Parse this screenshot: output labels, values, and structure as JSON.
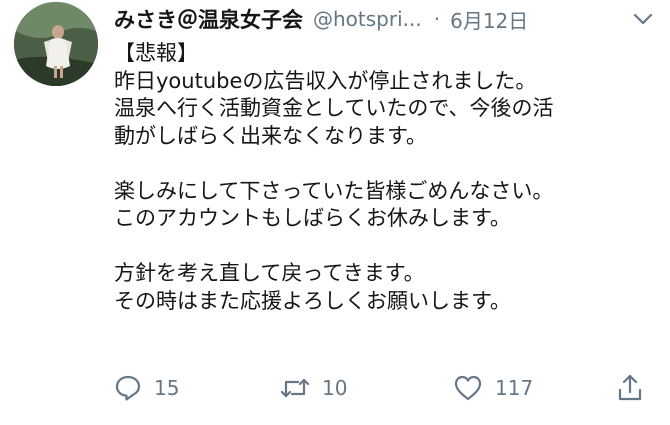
{
  "tweet": {
    "author": {
      "display_name": "みさき＠温泉女子会",
      "handle": "@hotspri...",
      "avatar_icon": "avatar-photo"
    },
    "separator": "·",
    "date": "6月12日",
    "menu_icon": "chevron-down-icon",
    "text_lines": [
      "【悲報】",
      "昨日youtubeの広告収入が停止されました。",
      "温泉へ行く活動資金としていたので、今後の活",
      "動がしばらく出来なくなります。",
      "",
      "楽しみにして下さっていた皆様ごめんなさい。",
      "このアカウントもしばらくお休みします。",
      "",
      "方針を考え直して戻ってきます。",
      "その時はまた応援よろしくお願いします。"
    ],
    "actions": {
      "reply": {
        "icon": "reply-icon",
        "count": "15"
      },
      "retweet": {
        "icon": "retweet-icon",
        "count": "10"
      },
      "like": {
        "icon": "heart-icon",
        "count": "117"
      },
      "share": {
        "icon": "share-icon"
      }
    }
  },
  "colors": {
    "text": "#14171a",
    "secondary": "#657786"
  }
}
